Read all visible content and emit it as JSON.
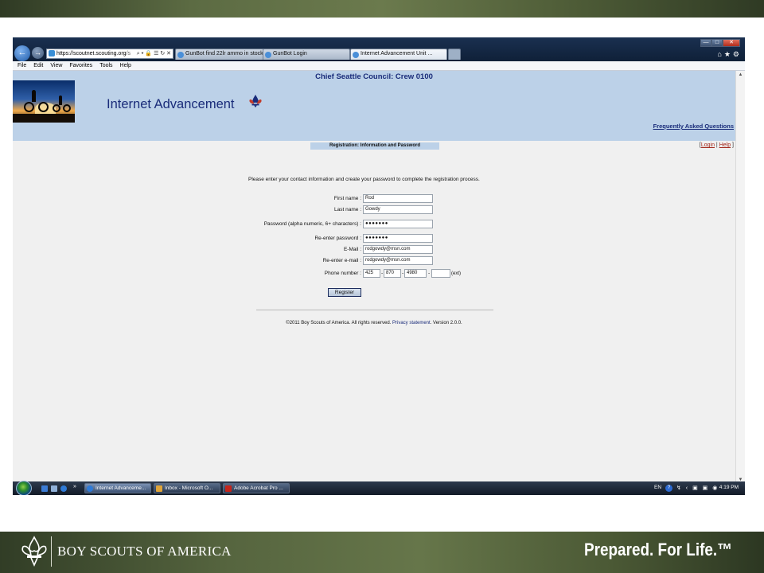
{
  "browser": {
    "address_url_host": "https://scoutnet.scouting.org",
    "address_url_suffix": "/s",
    "address_tools": "⌕ ▾ 🔒 ☰ ↻ ✕",
    "tabs": [
      {
        "label": "GunBot find 22lr ammo in stock",
        "active": false
      },
      {
        "label": "GunBot Login",
        "active": false
      },
      {
        "label": "Internet Advancement Unit ...",
        "active": true
      }
    ],
    "window_controls": {
      "minimize": "—",
      "maximize": "□",
      "close": "✕"
    },
    "toolbar_icons": "⌂★⚙",
    "menu": [
      "File",
      "Edit",
      "View",
      "Favorites",
      "Tools",
      "Help"
    ]
  },
  "page": {
    "council": "Chief Seattle Council: Crew 0100",
    "title": "Internet Advancement",
    "faq": "Frequently Asked Questions",
    "section_bar": "Registration: Information and Password",
    "toplinks": {
      "open": "[",
      "login": "Login",
      "sep": " | ",
      "help": "Help",
      "close": " ]"
    },
    "intro": "Please enter your contact information and create your password to complete the registration process.",
    "form": {
      "first_name": {
        "label": "First name :",
        "value": "Rod"
      },
      "last_name": {
        "label": "Last name :",
        "value": "Gowdy"
      },
      "password": {
        "label": "Password (alpha numeric, 6+ characters) :",
        "value": "●●●●●●●"
      },
      "reenter_password": {
        "label": "Re-enter password :",
        "value": "●●●●●●●"
      },
      "email": {
        "label": "E-Mail :",
        "value": "rodgowdy@msn.com"
      },
      "reenter_email": {
        "label": "Re-enter e-mail :",
        "value": "rodgowdy@msn.com"
      },
      "phone": {
        "label": "Phone number :",
        "area": "425",
        "prefix": "870",
        "line": "4980",
        "ext_value": "",
        "ext_label": "(ext)",
        "dash": "-"
      }
    },
    "register_button": "Register",
    "footer": {
      "copyright": "©2011 Boy Scouts of America. All rights reserved.",
      "privacy": "Privacy statement",
      "version": ". Version 2.0.0."
    }
  },
  "taskbar": {
    "buttons": [
      {
        "label": "Internet Advanceme...",
        "active": true,
        "icon_color": "#2f7ad6"
      },
      {
        "label": "Inbox - Microsoft O...",
        "active": false,
        "icon_color": "#e0a53a"
      },
      {
        "label": "Adobe Acrobat Pro ...",
        "active": false,
        "icon_color": "#c4251b"
      }
    ],
    "language": "EN",
    "help": "?",
    "tray_icons": "↯ ‹ ▣ ▣ ◉",
    "time": "4:19 PM",
    "quicklaunch_more": "»"
  },
  "slide": {
    "org_name": "BOY SCOUTS OF AMERICA",
    "tagline": "Prepared. For Life.™",
    "accent": "#1a2c7a",
    "banner_color": "#bcd1e8"
  }
}
